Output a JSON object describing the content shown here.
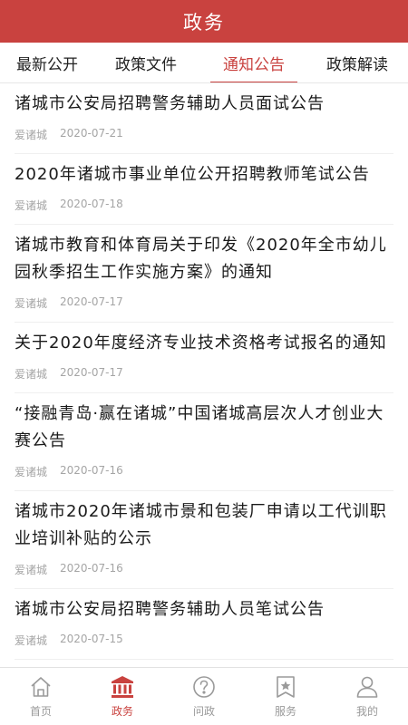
{
  "header": {
    "title": "政务"
  },
  "tabs": [
    {
      "label": "最新公开"
    },
    {
      "label": "政策文件"
    },
    {
      "label": "通知公告",
      "active": true
    },
    {
      "label": "政策解读"
    }
  ],
  "items": [
    {
      "title": "诸城市公安局招聘警务辅助人员面试公告",
      "source": "爱诸城",
      "date": "2020-07-21"
    },
    {
      "title": "2020年诸城市事业单位公开招聘教师笔试公告",
      "source": "爱诸城",
      "date": "2020-07-18"
    },
    {
      "title": "诸城市教育和体育局关于印发《2020年全市幼儿园秋季招生工作实施方案》的通知",
      "source": "爱诸城",
      "date": "2020-07-17"
    },
    {
      "title": "关于2020年度经济专业技术资格考试报名的通知",
      "source": "爱诸城",
      "date": "2020-07-17"
    },
    {
      "title": "“接融青岛·赢在诸城”中国诸城高层次人才创业大赛公告",
      "source": "爱诸城",
      "date": "2020-07-16"
    },
    {
      "title": "诸城市2020年诸城市景和包装厂申请以工代训职业培训补贴的公示",
      "source": "爱诸城",
      "date": "2020-07-16"
    },
    {
      "title": "诸城市公安局招聘警务辅助人员笔试公告",
      "source": "爱诸城",
      "date": "2020-07-15"
    }
  ],
  "tabbar": [
    {
      "label": "首页",
      "icon": "home-icon"
    },
    {
      "label": "政务",
      "icon": "government-building-icon",
      "active": true
    },
    {
      "label": "问政",
      "icon": "question-icon"
    },
    {
      "label": "服务",
      "icon": "service-star-icon"
    },
    {
      "label": "我的",
      "icon": "user-icon"
    }
  ],
  "colors": {
    "accent": "#c9423f",
    "muted": "#a5a5a5"
  }
}
